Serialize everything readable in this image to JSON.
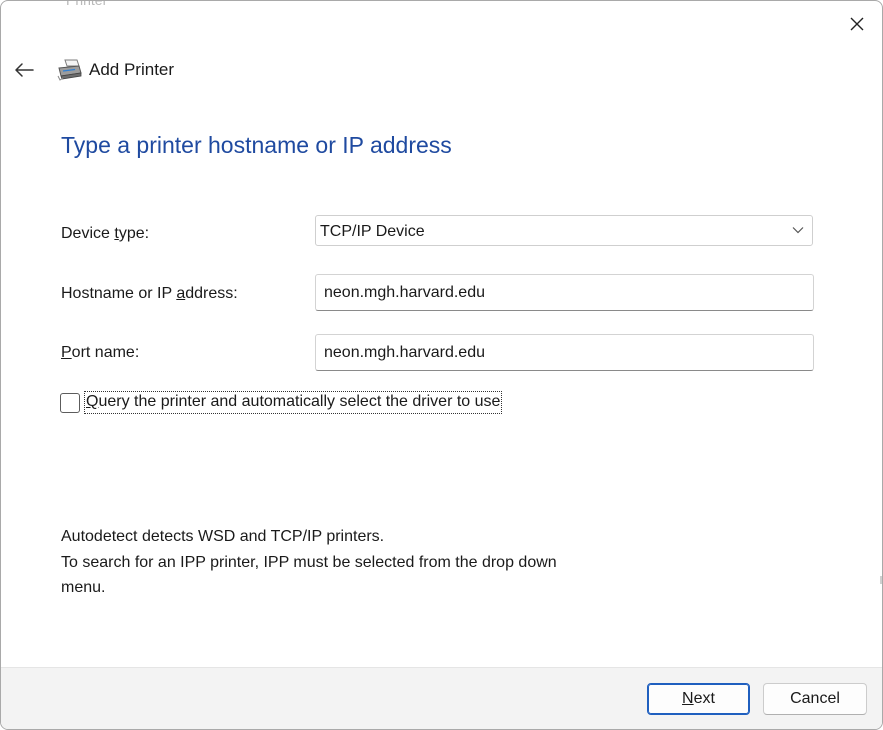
{
  "window": {
    "ghost_title": "Printer",
    "title": "Add Printer"
  },
  "heading": "Type a printer hostname or IP address",
  "form": {
    "device_type": {
      "label_pre": "Device ",
      "label_key": "t",
      "label_post": "ype:",
      "value": "TCP/IP Device"
    },
    "hostname": {
      "label_pre": "Hostname or IP ",
      "label_key": "a",
      "label_post": "ddress:",
      "value": "neon.mgh.harvard.edu"
    },
    "port": {
      "label_pre": "",
      "label_key": "P",
      "label_post": "ort name:",
      "value": "neon.mgh.harvard.edu"
    },
    "query_checkbox": {
      "label_key": "Q",
      "label_post": "uery the printer and automatically select the driver to use",
      "checked": false
    }
  },
  "info": {
    "line1": "Autodetect detects WSD and TCP/IP printers.",
    "line2": "To search for an IPP printer, IPP must be selected from the drop down",
    "line3": "menu."
  },
  "buttons": {
    "next_key": "N",
    "next_rest": "ext",
    "cancel": "Cancel"
  },
  "icons": {
    "close": "close-icon",
    "back": "back-arrow-icon",
    "printer": "printer-icon",
    "dropdown": "chevron-down-icon"
  },
  "colors": {
    "heading": "#1f4aa0",
    "default_button_border": "#1f5fbf",
    "footer_bg": "#f3f3f3"
  }
}
